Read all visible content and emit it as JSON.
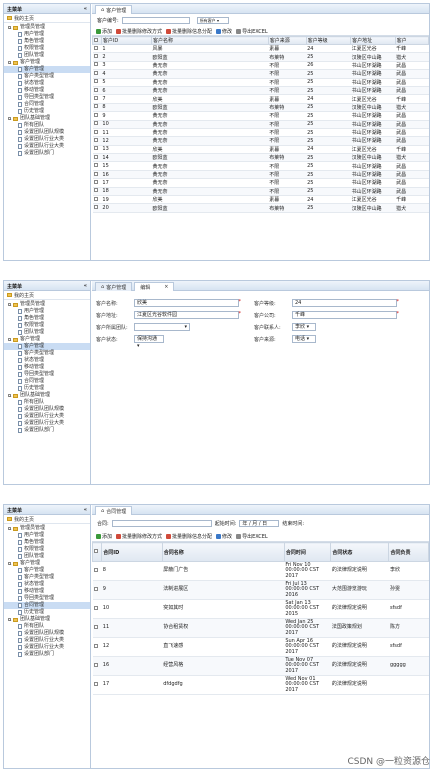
{
  "sidebar": {
    "title": "主菜单",
    "collapse": "«",
    "home": "我的主页",
    "groups": [
      {
        "label": "管理员管理",
        "items": [
          "用户管理",
          "角色管理",
          "权限管理",
          "团队管理"
        ]
      },
      {
        "label": "客户管理",
        "items": [
          "客户管理",
          "客户类型管理",
          "状态管理",
          "移动管理",
          "导回类型管理",
          "合同管理",
          "历史管理"
        ]
      },
      {
        "label": "团队基础管理",
        "items": [
          "所有团队",
          "设置团队团队规模",
          "设置团队行业大类",
          "设置团队行业大类",
          "设置团队部门"
        ]
      }
    ]
  },
  "panel1": {
    "tab": "客户管理",
    "search_label": "客户编号:",
    "select": "所有客户",
    "toolbar": [
      "添加",
      "批量删除修改方式",
      "批量删除信息分配",
      "修改",
      "导出EXCEL"
    ],
    "cols": [
      "客户ID",
      "客户名称",
      "客户来源",
      "客户等级",
      "客户地址",
      "客户"
    ],
    "rows": [
      [
        "1",
        "风暴",
        "素暮",
        "24",
        "江夏区光谷",
        "千峰"
      ],
      [
        "2",
        "欧阳蓝",
        "布莱特",
        "25",
        "汉陵区中山路",
        "猎犬"
      ],
      [
        "3",
        "黄无奈",
        "不限",
        "26",
        "书山区环湖路",
        "武昌"
      ],
      [
        "4",
        "黄无奈",
        "不限",
        "25",
        "书山区环湖路",
        "武昌"
      ],
      [
        "5",
        "黄无奈",
        "不限",
        "25",
        "书山区环湖路",
        "武昌"
      ],
      [
        "6",
        "黄无奈",
        "不限",
        "25",
        "书山区环湖路",
        "武昌"
      ],
      [
        "7",
        "欣美",
        "素暮",
        "24",
        "江夏区光谷",
        "千峰"
      ],
      [
        "8",
        "欧阳蓝",
        "布莱特",
        "25",
        "汉陵区中山路",
        "猎犬"
      ],
      [
        "9",
        "黄无奈",
        "不限",
        "25",
        "书山区环湖路",
        "武昌"
      ],
      [
        "10",
        "黄无奈",
        "不限",
        "25",
        "书山区环湖路",
        "武昌"
      ],
      [
        "11",
        "黄无奈",
        "不限",
        "25",
        "书山区环湖路",
        "武昌"
      ],
      [
        "12",
        "黄无奈",
        "不限",
        "25",
        "书山区环湖路",
        "武昌"
      ],
      [
        "13",
        "欣美",
        "素暮",
        "24",
        "江夏区光谷",
        "千峰"
      ],
      [
        "14",
        "欧阳蓝",
        "布莱特",
        "25",
        "汉陵区中山路",
        "猎犬"
      ],
      [
        "15",
        "黄无奈",
        "不限",
        "25",
        "书山区环湖路",
        "武昌"
      ],
      [
        "16",
        "黄无奈",
        "不限",
        "25",
        "书山区环湖路",
        "武昌"
      ],
      [
        "17",
        "黄无奈",
        "不限",
        "25",
        "书山区环湖路",
        "武昌"
      ],
      [
        "18",
        "黄无奈",
        "不限",
        "25",
        "书山区环湖路",
        "武昌"
      ],
      [
        "19",
        "欣美",
        "素暮",
        "24",
        "江夏区光谷",
        "千峰"
      ],
      [
        "20",
        "欧阳蓝",
        "布莱特",
        "25",
        "汉陵区中山路",
        "猎犬"
      ]
    ]
  },
  "panel2": {
    "tabs": [
      "客户管理",
      "编辑"
    ],
    "fields": {
      "name_l": "客户名称:",
      "name_v": "欣美",
      "level_l": "客户等级:",
      "level_v": "24",
      "addr_l": "客户地址:",
      "addr_v": "江夏区光谷软件园",
      "company_l": "客户公司:",
      "company_v": "千峰",
      "team_l": "客户所属团队:",
      "team_v": "",
      "contact_l": "客户联系人:",
      "contact_v": "李欣",
      "status_l": "客户状态:",
      "status_v": "保持沟通",
      "source_l": "客户来源:",
      "source_v": "电话"
    }
  },
  "panel3": {
    "tab": "合同管理",
    "search_l": "合同:",
    "date_l": "起始时间:",
    "date_v": "年 / 月 / 日",
    "end_l": "结束时间:",
    "toolbar": [
      "添加",
      "批量删除修改方式",
      "批量删除信息分配",
      "修改",
      "导出EXCEL"
    ],
    "cols": [
      "合同ID",
      "合同名称",
      "合同时间",
      "合同状态",
      "合同负责"
    ],
    "rows": [
      [
        "8",
        "屏蔽门广告",
        "Fri Nov 10 00:00:00 CST 2017",
        "的法律规定说明",
        "李欣"
      ],
      [
        "9",
        "法制进展区",
        "Fri Jul 13 00:00:00 CST 2016",
        "大范围游览游玩",
        "孙雯"
      ],
      [
        "10",
        "突如其时",
        "Sat Jan 13 00:00:00 CST 2015",
        "的法律规定说明",
        "sfsdf"
      ],
      [
        "11",
        "协合租赁权",
        "Wed Jan 25 00:00:00 CST 2017",
        "法国政策规划",
        "陈方"
      ],
      [
        "12",
        "直飞速感",
        "Sun Apr 16 00:00:00 CST 2017",
        "的法律规定说明",
        "sfsdf"
      ],
      [
        "16",
        "经营风格",
        "Tue Nov 07 00:00:00 CST 2017",
        "的法律规定说明",
        "ggggg"
      ],
      [
        "17",
        "dfdgdfg",
        "Wed Nov 01 00:00:00 CST 2017",
        "的法律规定说明",
        ""
      ]
    ]
  },
  "watermark": "CSDN @一粒资源仓"
}
